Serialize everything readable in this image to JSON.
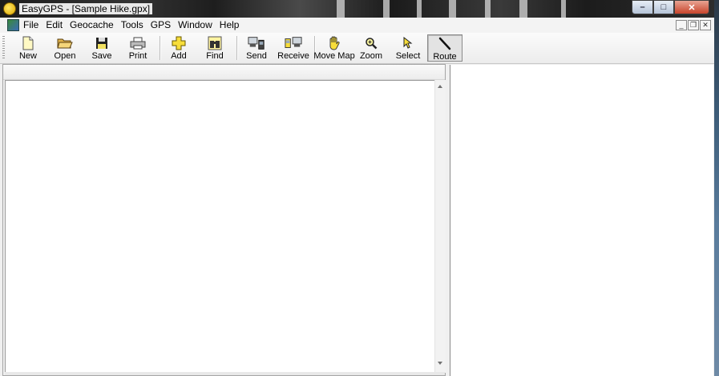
{
  "window": {
    "title": "EasyGPS - [Sample Hike.gpx]",
    "controls": {
      "minimize": "–",
      "maximize": "□",
      "close": "✕"
    }
  },
  "menubar": {
    "items": [
      "File",
      "Edit",
      "Geocache",
      "Tools",
      "GPS",
      "Window",
      "Help"
    ],
    "mdi": {
      "minimize": "_",
      "restore": "❐",
      "close": "✕"
    }
  },
  "toolbar": {
    "buttons": [
      {
        "label": "New",
        "icon": "new-file-icon"
      },
      {
        "label": "Open",
        "icon": "open-folder-icon"
      },
      {
        "label": "Save",
        "icon": "floppy-disk-icon"
      },
      {
        "label": "Print",
        "icon": "printer-icon"
      },
      {
        "label": "Add",
        "icon": "plus-icon"
      },
      {
        "label": "Find",
        "icon": "binoculars-icon"
      },
      {
        "label": "Send",
        "icon": "send-to-gps-icon"
      },
      {
        "label": "Receive",
        "icon": "receive-from-gps-icon"
      },
      {
        "label": "Move Map",
        "icon": "hand-icon"
      },
      {
        "label": "Zoom",
        "icon": "magnifier-icon"
      },
      {
        "label": "Select",
        "icon": "arrow-cursor-icon"
      },
      {
        "label": "Route",
        "icon": "route-pen-icon",
        "pressed": true
      }
    ]
  },
  "colors": {
    "accent_close": "#c8442b",
    "icon_yellow": "#f7dd3a",
    "icon_dark": "#222222"
  }
}
